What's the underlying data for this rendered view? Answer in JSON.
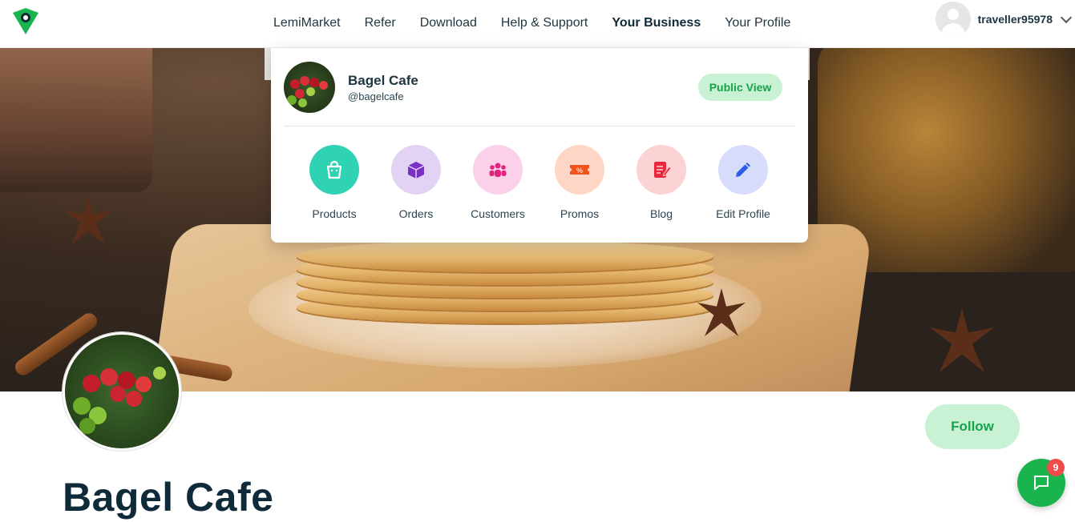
{
  "nav": {
    "items": [
      {
        "label": "LemiMarket",
        "active": false
      },
      {
        "label": "Refer",
        "active": false
      },
      {
        "label": "Download",
        "active": false
      },
      {
        "label": "Help & Support",
        "active": false
      },
      {
        "label": "Your Business",
        "active": true
      },
      {
        "label": "Your Profile",
        "active": false
      }
    ],
    "username": "traveller95978"
  },
  "dropdown": {
    "business_name": "Bagel Cafe",
    "business_handle": "@bagelcafe",
    "public_view_label": "Public View",
    "actions": [
      {
        "label": "Products",
        "icon": "shopping-bag-icon",
        "bg": "#2fd3b3",
        "fg": "#ffffff"
      },
      {
        "label": "Orders",
        "icon": "package-icon",
        "bg": "#e2d3f4",
        "fg": "#7b2fc6"
      },
      {
        "label": "Customers",
        "icon": "people-icon",
        "bg": "#fbd1ea",
        "fg": "#e0257f"
      },
      {
        "label": "Promos",
        "icon": "ticket-icon",
        "bg": "#fdd6c6",
        "fg": "#f0541e"
      },
      {
        "label": "Blog",
        "icon": "blog-icon",
        "bg": "#fbd3d5",
        "fg": "#e8283b"
      },
      {
        "label": "Edit Profile",
        "icon": "pencil-icon",
        "bg": "#d7dcfb",
        "fg": "#2b5ee6"
      }
    ]
  },
  "profile": {
    "title": "Bagel Cafe",
    "follow_label": "Follow"
  },
  "chat": {
    "badge_count": "9"
  },
  "colors": {
    "brand_green": "#19b44d",
    "follow_bg": "#c8f2d3",
    "text_dark": "#0f2b3a"
  }
}
